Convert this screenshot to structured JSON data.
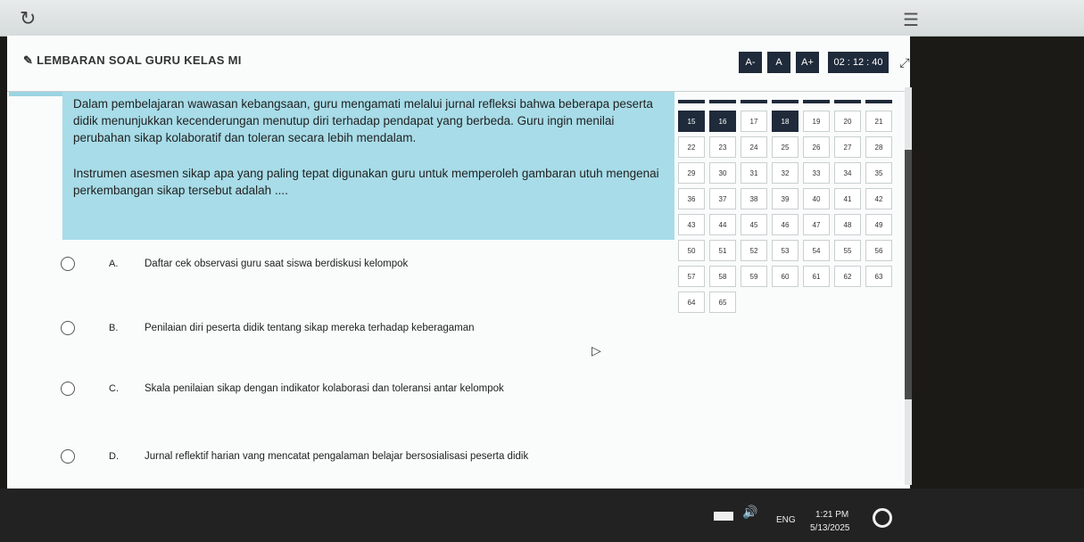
{
  "browser": {
    "reload_icon": "reload-icon",
    "menu_icon": "hamburger-icon"
  },
  "header": {
    "title": "LEMBARAN SOAL GURU KELAS MI",
    "font_small": "A-",
    "font_normal": "A",
    "font_large": "A+",
    "timer": "02 : 12 : 40",
    "expand_icon": "expand-icon"
  },
  "question": {
    "paragraph1": "Dalam pembelajaran wawasan kebangsaan, guru mengamati melalui jurnal refleksi bahwa beberapa peserta didik menunjukkan kecenderungan menutup diri terhadap pendapat yang berbeda. Guru ingin menilai perubahan sikap kolaboratif dan toleran secara lebih mendalam.",
    "paragraph2": "Instrumen asesmen sikap apa yang paling tepat digunakan guru untuk memperoleh gambaran utuh mengenai perkembangan sikap tersebut adalah ...."
  },
  "options": [
    {
      "letter": "A.",
      "text": "Daftar cek observasi guru saat siswa berdiskusi kelompok"
    },
    {
      "letter": "B.",
      "text": "Penilaian diri peserta didik tentang sikap mereka terhadap keberagaman"
    },
    {
      "letter": "C.",
      "text": "Skala penilaian sikap dengan indikator kolaborasi dan toleransi antar kelompok"
    },
    {
      "letter": "D.",
      "text": "Jurnal reflektif harian vang mencatat pengalaman belajar bersosialisasi peserta didik"
    }
  ],
  "navigator": {
    "numbers": [
      "15",
      "16",
      "17",
      "18",
      "19",
      "20",
      "21",
      "22",
      "23",
      "24",
      "25",
      "26",
      "27",
      "28",
      "29",
      "30",
      "31",
      "32",
      "33",
      "34",
      "35",
      "36",
      "37",
      "38",
      "39",
      "40",
      "41",
      "42",
      "43",
      "44",
      "45",
      "46",
      "47",
      "48",
      "49",
      "50",
      "51",
      "52",
      "53",
      "54",
      "55",
      "56",
      "57",
      "58",
      "59",
      "60",
      "61",
      "62",
      "63",
      "64",
      "65"
    ],
    "answered": [
      "15",
      "16",
      "18"
    ]
  },
  "taskbar": {
    "language": "ENG",
    "time": "1:21 PM",
    "date": "5/13/2025"
  },
  "colors": {
    "accent_dark": "#1f2a3a",
    "question_bg": "#a7dce8"
  }
}
